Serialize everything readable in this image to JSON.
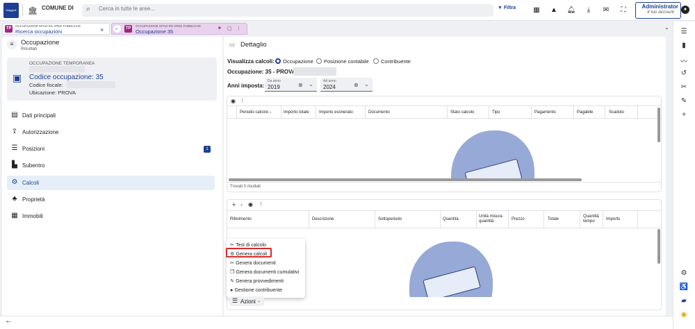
{
  "header": {
    "logo_text": "Maggioli",
    "municipality": "COMUNE DI",
    "search_placeholder": "Cerca in tutte le aree...",
    "filter_label": "Filtra",
    "user_name": "Administrator",
    "user_role": "Il tuo account"
  },
  "tabs": [
    {
      "subtitle": "OCCUPAZIONE SPAZI ED AREE PUBBLICHE",
      "title": "Ricerca occupazioni",
      "close": "×"
    },
    {
      "subtitle": "OCCUPAZIONE SPAZI ED AREE PUBBLICHE",
      "title": "Occupazione 35"
    }
  ],
  "left": {
    "title": "Occupazione",
    "subtitle": "Risultati",
    "card": {
      "type": "OCCUPAZIONE TEMPORANEA",
      "code": "Codice occupazione: 35",
      "codice_fiscale": "Codice fiscale:",
      "ubicazione": "Ubicazione: PROVA"
    },
    "nav": [
      {
        "label": "Dati principali"
      },
      {
        "label": "Autorizzazione"
      },
      {
        "label": "Posizioni",
        "badge": "1"
      },
      {
        "label": "Subentro"
      },
      {
        "label": "Calcoli"
      },
      {
        "label": "Proprietà"
      },
      {
        "label": "Immobili"
      }
    ]
  },
  "main": {
    "title": "Dettaglio",
    "visualizza_label": "Visualizza calcoli:",
    "radio": [
      "Occupazione",
      "Posizione contabile",
      "Contribuente"
    ],
    "occupazione_label": "Occupazione: 35 - PROVA -",
    "anni_label": "Anni imposta:",
    "da_anno_label": "Da anno",
    "da_anno_value": "2019",
    "ad_anno_label": "Ad anno",
    "ad_anno_value": "2024",
    "table1": {
      "columns": [
        "Periodo calcolo",
        "Importo totale",
        "Importo esonerato",
        "Documento",
        "Stato calcolo",
        "Tipo",
        "Pagamento",
        "Pagabile",
        "Scaduto"
      ],
      "footer": "Trovati 0 risultati"
    },
    "table2": {
      "columns": [
        "Riferimento",
        "Descrizione",
        "Sottoperiodo",
        "Quantità",
        "Unità misura quantità",
        "Prezzo",
        "Totale",
        "Quantità tempo",
        "Importo"
      ]
    },
    "menu": [
      "Test di calcolo",
      "Genera calcoli",
      "Genera documenti",
      "Genera documenti cumulativi",
      "Genera provvedimenti",
      "Gestione contribuente"
    ],
    "azioni_label": "Azioni"
  }
}
